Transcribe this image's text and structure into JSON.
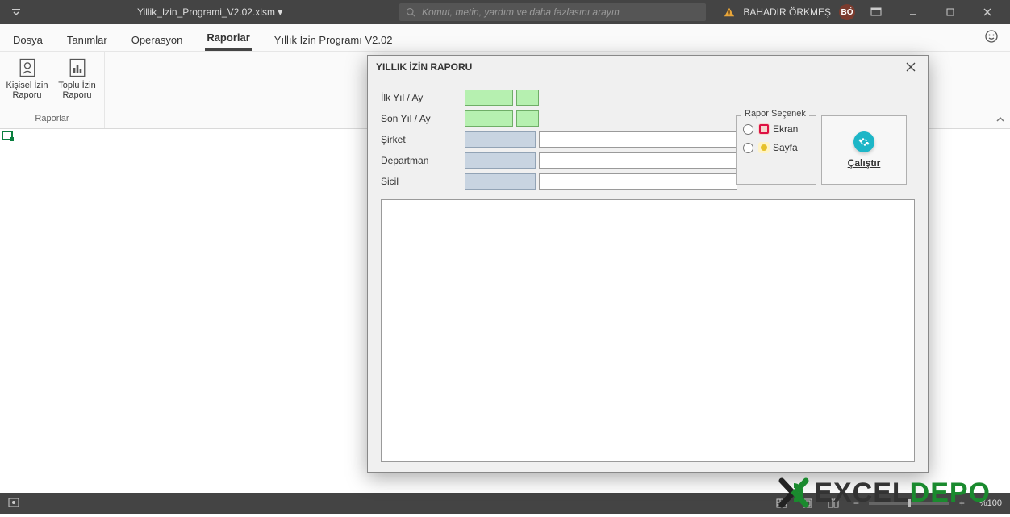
{
  "titlebar": {
    "filename": "Yillik_Izin_Programi_V2.02.xlsm ▾",
    "search_placeholder": "Komut, metin, yardım ve daha fazlasını arayın",
    "username": "BAHADIR ÖRKMEŞ",
    "user_initials": "BÖ"
  },
  "tabs": {
    "t0": "Dosya",
    "t1": "Tanımlar",
    "t2": "Operasyon",
    "t3": "Raporlar",
    "t4": "Yıllık İzin Programı V2.02"
  },
  "ribbon": {
    "btn1_line1": "Kişisel İzin",
    "btn1_line2": "Raporu",
    "btn2_line1": "Toplu İzin",
    "btn2_line2": "Raporu",
    "group_label": "Raporlar"
  },
  "dialog": {
    "title": "YILLIK İZİN RAPORU",
    "lbl_ilk": "İlk Yıl / Ay",
    "lbl_son": "Son Yıl / Ay",
    "lbl_sirket": "Şirket",
    "lbl_dept": "Departman",
    "lbl_sicil": "Sicil",
    "options_title": "Rapor Seçenek",
    "opt_ekran": "Ekran",
    "opt_sayfa": "Sayfa",
    "run_label": "Çalıştır"
  },
  "status": {
    "zoom": "%100"
  },
  "watermark": {
    "text_left": "EXCEL",
    "text_right": "DEPO"
  }
}
